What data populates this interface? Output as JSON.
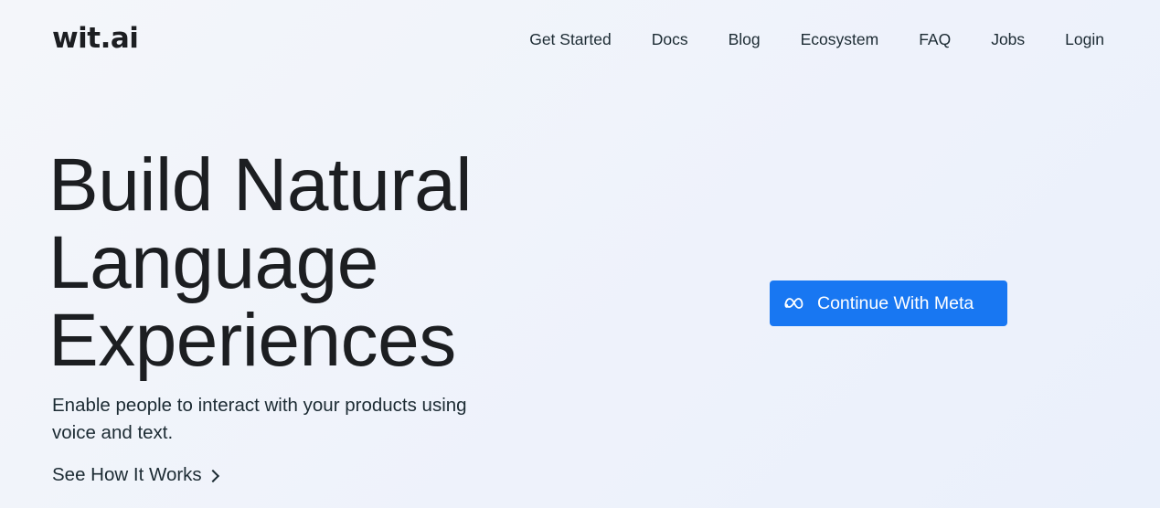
{
  "header": {
    "logo_text": "wit.ai",
    "nav": [
      {
        "label": "Get Started"
      },
      {
        "label": "Docs"
      },
      {
        "label": "Blog"
      },
      {
        "label": "Ecosystem"
      },
      {
        "label": "FAQ"
      },
      {
        "label": "Jobs"
      },
      {
        "label": "Login"
      }
    ]
  },
  "hero": {
    "title_lines": [
      "Build Natural",
      "Language",
      "Experiences"
    ],
    "subtitle": "Enable people to interact with your products using voice and text.",
    "cta_link": "See How It Works"
  },
  "auth": {
    "button_label": "Continue With Meta",
    "button_icon": "meta-logo-icon",
    "button_color": "#1877f2"
  },
  "colors": {
    "text_primary": "#1c1e21",
    "text_secondary": "#1c2b33",
    "accent": "#1877f2"
  }
}
